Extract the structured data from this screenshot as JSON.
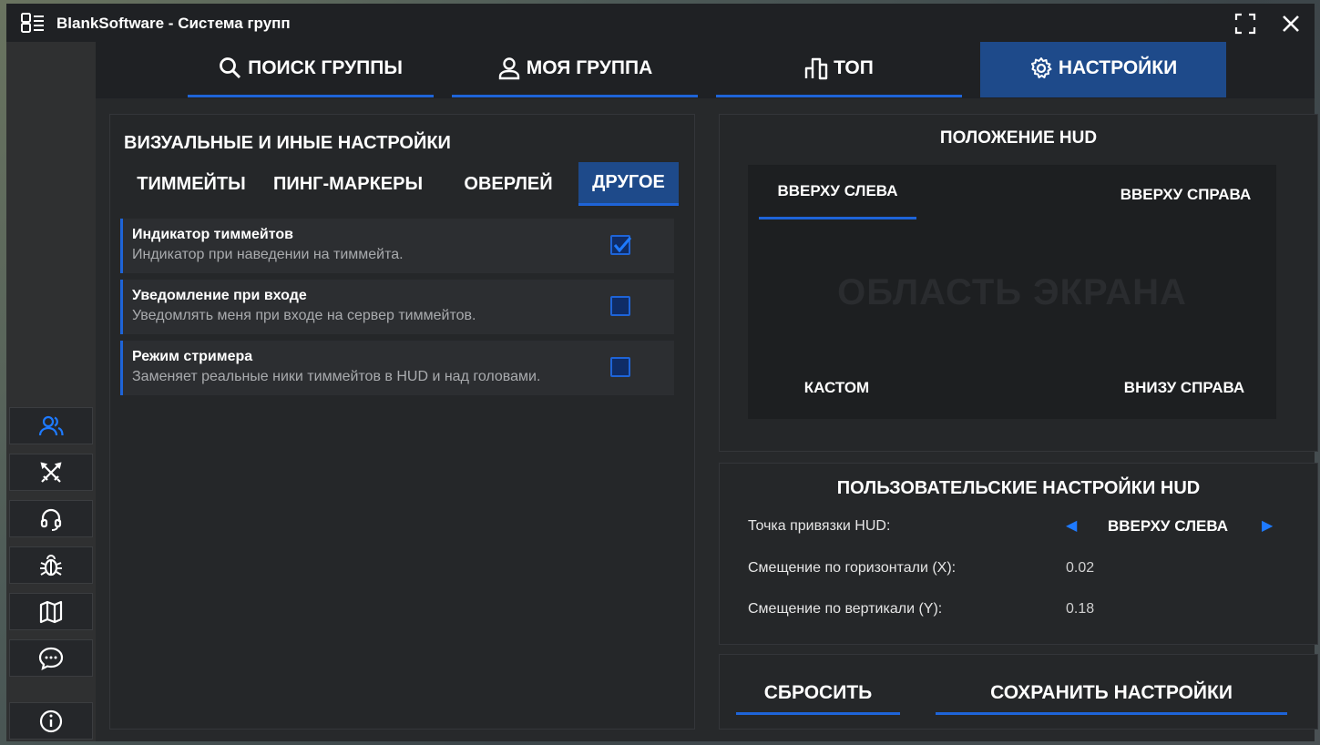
{
  "window": {
    "title": "BlankSoftware - Система групп",
    "app_icon": "menu-list-icon",
    "maximize_icon": "maximize-icon",
    "close_icon": "close-icon"
  },
  "top_tabs": [
    {
      "label": "ПОИСК ГРУППЫ",
      "icon": "search-icon"
    },
    {
      "label": "МОЯ ГРУППА",
      "icon": "user-icon"
    },
    {
      "label": "ТОП",
      "icon": "bar-chart-icon"
    },
    {
      "label": "НАСТРОЙКИ",
      "icon": "gear-icon",
      "active": true
    }
  ],
  "sidebar": {
    "items": [
      {
        "icon": "users-icon",
        "active": true
      },
      {
        "icon": "crossed-swords-icon"
      },
      {
        "icon": "headset-icon"
      },
      {
        "icon": "bug-icon"
      },
      {
        "icon": "map-icon"
      },
      {
        "icon": "chat-icon"
      },
      {
        "icon": "info-icon"
      }
    ]
  },
  "visual_settings": {
    "title": "ВИЗУАЛЬНЫЕ И ИНЫЕ НАСТРОЙКИ",
    "subtabs": [
      {
        "label": "ТИММЕЙТЫ"
      },
      {
        "label": "ПИНГ-МАРКЕРЫ"
      },
      {
        "label": "ОВЕРЛЕЙ"
      },
      {
        "label": "ДРУГОЕ",
        "active": true
      }
    ],
    "options": [
      {
        "title": "Индикатор тиммейтов",
        "desc": "Индикатор при наведении на тиммейта.",
        "checked": true
      },
      {
        "title": "Уведомление при входе",
        "desc": "Уведомлять меня при входе на сервер тиммейтов.",
        "checked": false
      },
      {
        "title": "Режим стримера",
        "desc": "Заменяет реальные ники тиммейтов в HUD и над головами.",
        "checked": false
      }
    ]
  },
  "hud_position": {
    "title": "ПОЛОЖЕНИЕ HUD",
    "watermark": "ОБЛАСТЬ ЭКРАНА",
    "top_left": "ВВЕРХУ СЛЕВА",
    "top_right": "ВВЕРХУ СПРАВА",
    "custom": "КАСТОМ",
    "bottom_right": "ВНИЗУ СПРАВА",
    "selected": "ВВЕРХУ СЛЕВА"
  },
  "hud_custom": {
    "title": "ПОЛЬЗОВАТЕЛЬСКИЕ НАСТРОЙКИ HUD",
    "anchor_label": "Точка привязки HUD:",
    "anchor_value": "ВВЕРХУ СЛЕВА",
    "offset_x_label": "Смещение по горизонтали (X):",
    "offset_x_value": "0.02",
    "offset_y_label": "Смещение по вертикали (Y):",
    "offset_y_value": "0.18"
  },
  "actions": {
    "reset_label": "СБРОСИТЬ",
    "save_label": "СОХРАНИТЬ НАСТРОЙКИ"
  },
  "colors": {
    "accent": "#1e64d8",
    "active_tab": "#1e4a8a",
    "panel": "#252729"
  }
}
